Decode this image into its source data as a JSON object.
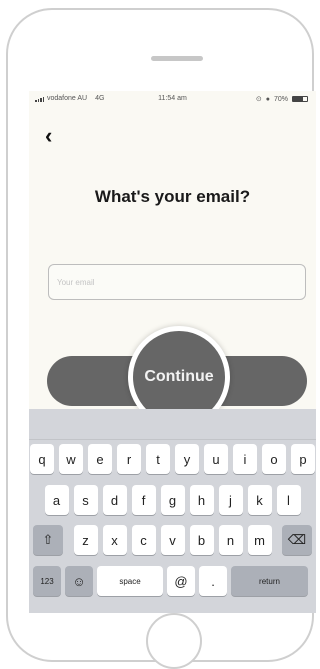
{
  "status_bar": {
    "carrier": "vodafone AU",
    "network": "4G",
    "time": "11:54 am",
    "battery": "70%"
  },
  "screen": {
    "title": "What's your email?",
    "email_placeholder": "Your email",
    "continue_label": "Continue"
  },
  "keyboard": {
    "row1": [
      "q",
      "w",
      "e",
      "r",
      "t",
      "y",
      "u",
      "i",
      "o",
      "p"
    ],
    "row2": [
      "a",
      "s",
      "d",
      "f",
      "g",
      "h",
      "j",
      "k",
      "l"
    ],
    "row3": [
      "z",
      "x",
      "c",
      "v",
      "b",
      "n",
      "m"
    ],
    "numbers_label": "123",
    "space_label": "space",
    "at_label": "@",
    "dot_label": ".",
    "return_label": "return"
  },
  "colors": {
    "screen_bg": "#faf9f3",
    "button_bg": "#666666",
    "keyboard_bg": "#d3d5da"
  },
  "icons": {
    "back": "chevron-left-icon",
    "shift": "shift-arrow-icon",
    "delete": "backspace-icon",
    "emoji": "emoji-icon"
  }
}
